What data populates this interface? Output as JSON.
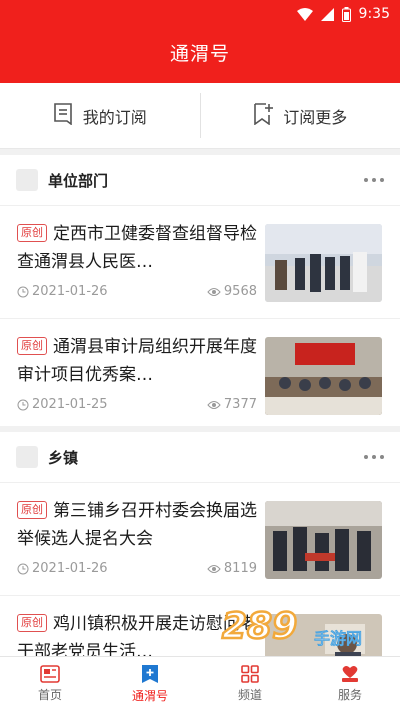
{
  "status": {
    "time": "9:35"
  },
  "header": {
    "title": "通渭号"
  },
  "subbar": {
    "my_subscription": "我的订阅",
    "subscribe_more": "订阅更多"
  },
  "sections": [
    {
      "name": "单位部门",
      "items": [
        {
          "tag": "原创",
          "headline": "定西市卫健委督查组督导检查通渭县人民医…",
          "date": "2021-01-26",
          "views": "9568"
        },
        {
          "tag": "原创",
          "headline": "通渭县审计局组织开展年度审计项目优秀案…",
          "date": "2021-01-25",
          "views": "7377"
        }
      ]
    },
    {
      "name": "乡镇",
      "items": [
        {
          "tag": "原创",
          "headline": "第三铺乡召开村委会换届选举候选人提名大会",
          "date": "2021-01-26",
          "views": "8119"
        },
        {
          "tag": "原创",
          "headline": "鸡川镇积极开展走访慰问老干部老党员生活…",
          "date": "",
          "views": ""
        }
      ]
    }
  ],
  "bottomnav": [
    {
      "label": "首页",
      "icon": "news-icon"
    },
    {
      "label": "通渭号",
      "icon": "plus-doc-icon"
    },
    {
      "label": "频道",
      "icon": "grid-icon"
    },
    {
      "label": "服务",
      "icon": "service-icon"
    }
  ],
  "watermark": {
    "text": "289",
    "sub": "手游网"
  },
  "colors": {
    "brand": "#f0201c",
    "tag": "#e03a3a",
    "meta": "#9a9a9a"
  }
}
